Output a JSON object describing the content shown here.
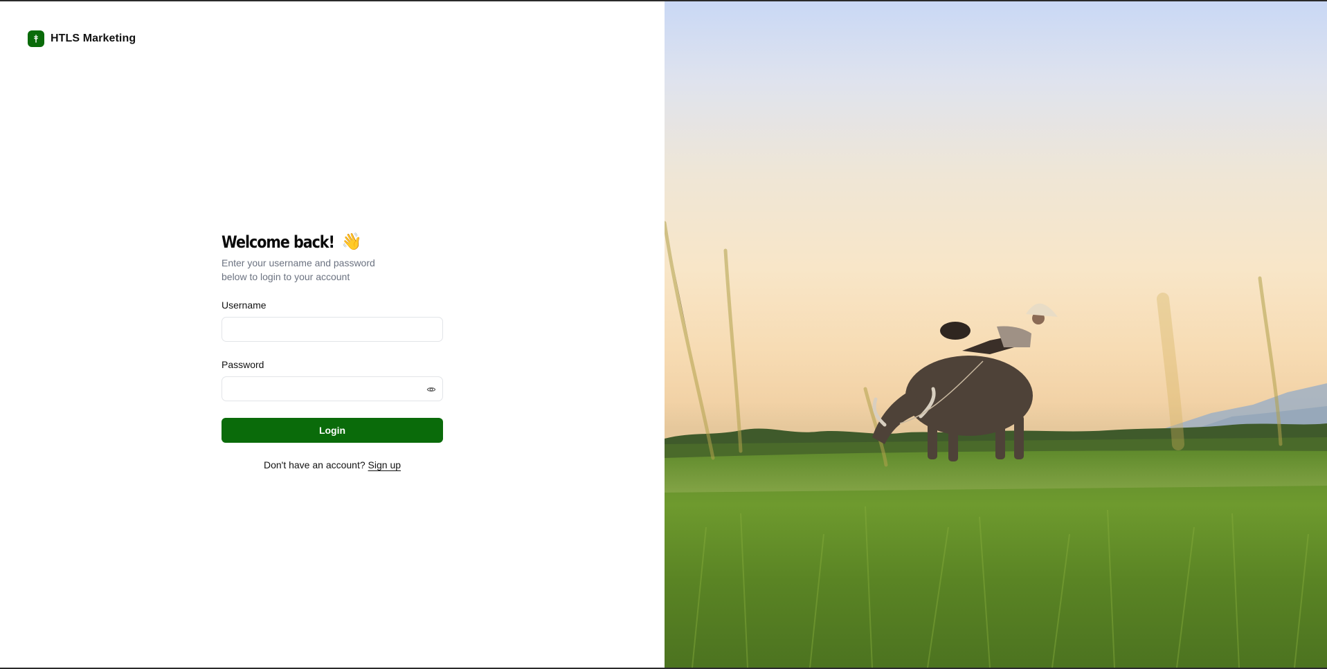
{
  "brand": {
    "name": "HTLS Marketing",
    "logo_icon": "sprout-icon",
    "accent_color": "#0a6b0a"
  },
  "login": {
    "title": "Welcome back!",
    "title_emoji": "👋",
    "subtitle": "Enter your username and password below to login to your account",
    "username_label": "Username",
    "username_value": "",
    "password_label": "Password",
    "password_value": "",
    "show_password_icon": "eye-icon",
    "submit_label": "Login",
    "signup_prompt": "Don't have an account?",
    "signup_link": "Sign up"
  },
  "hero": {
    "image_subject": "farmer-on-water-buffalo-in-rice-field"
  }
}
